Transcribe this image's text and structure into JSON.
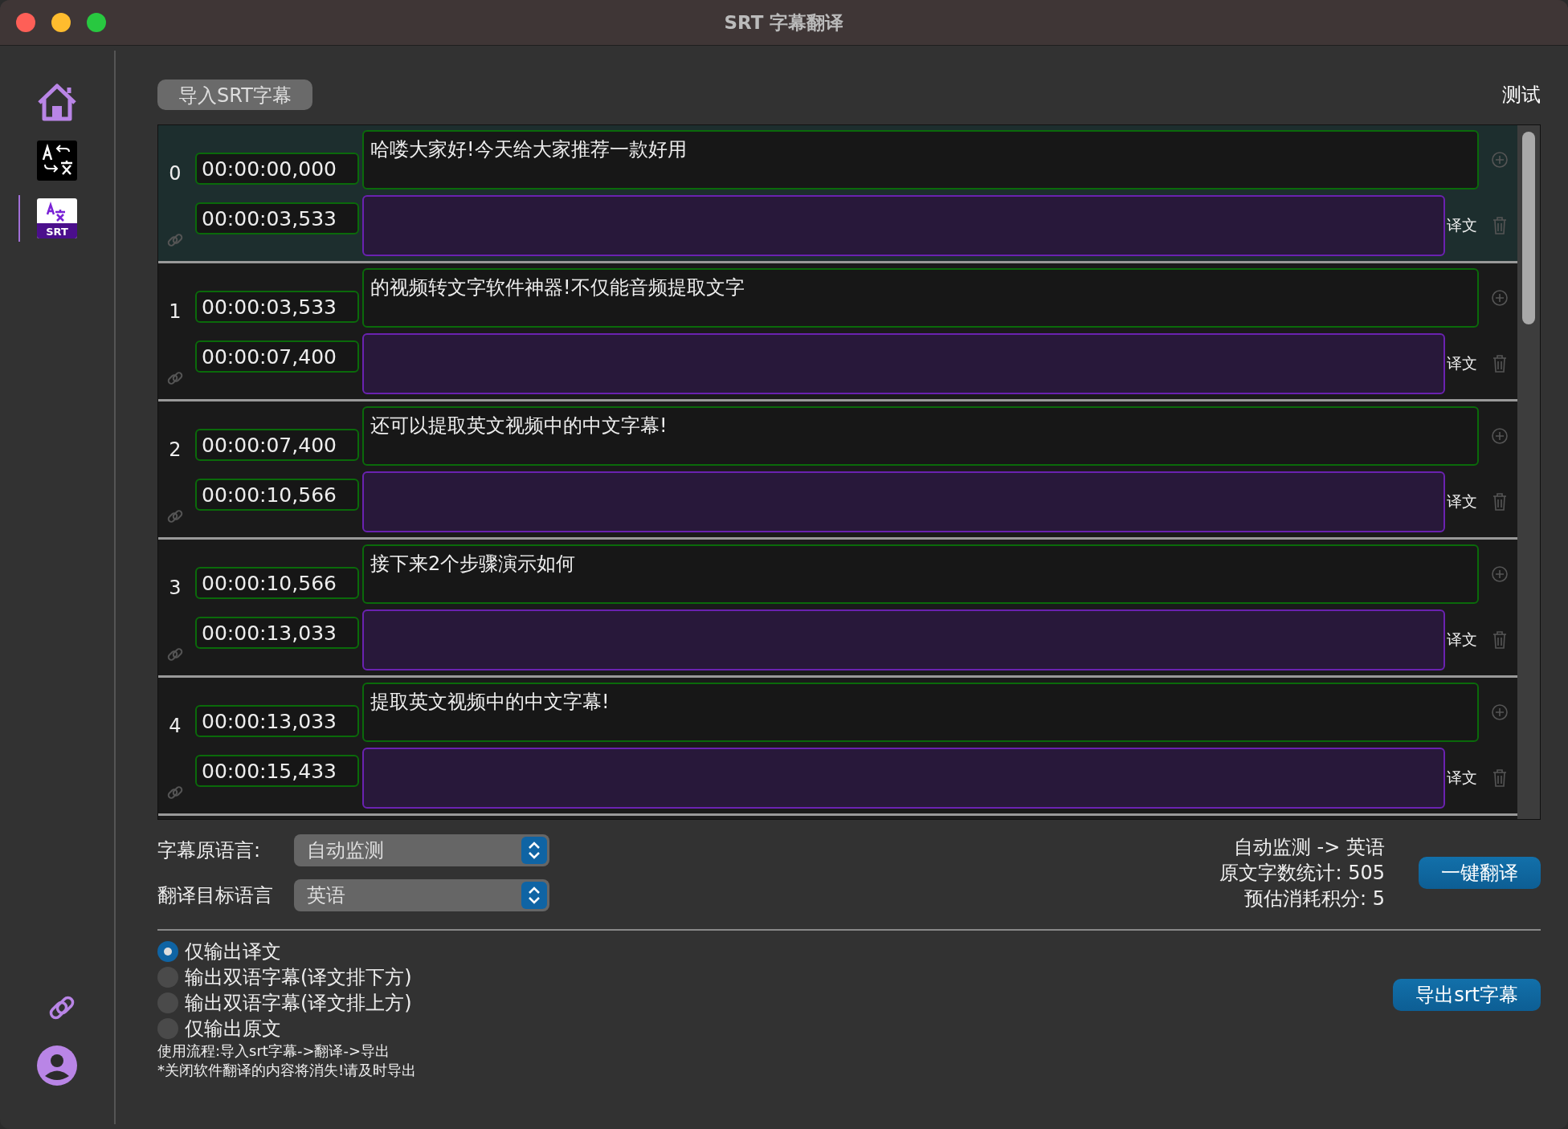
{
  "window": {
    "title": "SRT 字幕翻译"
  },
  "sidebar": {
    "items": [
      {
        "kind": "home",
        "selected": false
      },
      {
        "kind": "translate",
        "selected": false
      },
      {
        "kind": "srt",
        "label": "SRT",
        "selected": true
      }
    ],
    "bottom_items": [
      {
        "kind": "link"
      },
      {
        "kind": "account"
      }
    ]
  },
  "toolbar": {
    "import_button": "导入SRT字幕",
    "test_label": "测试"
  },
  "subtitles": [
    {
      "index": "0",
      "start": "00:00:00,000",
      "end": "00:00:03,533",
      "source": "哈喽大家好!今天给大家推荐一款好用",
      "translation_label": "译文",
      "selected": true
    },
    {
      "index": "1",
      "start": "00:00:03,533",
      "end": "00:00:07,400",
      "source": "的视频转文字软件神器!不仅能音频提取文字",
      "translation_label": "译文",
      "selected": false
    },
    {
      "index": "2",
      "start": "00:00:07,400",
      "end": "00:00:10,566",
      "source": "还可以提取英文视频中的中文字幕!",
      "translation_label": "译文",
      "selected": false
    },
    {
      "index": "3",
      "start": "00:00:10,566",
      "end": "00:00:13,033",
      "source": "接下来2个步骤演示如何",
      "translation_label": "译文",
      "selected": false
    },
    {
      "index": "4",
      "start": "00:00:13,033",
      "end": "00:00:15,433",
      "source": "提取英文视频中的中文字幕!",
      "translation_label": "译文",
      "selected": false
    }
  ],
  "settings": {
    "source_language_label": "字幕原语言:",
    "source_language": "自动监测",
    "target_language_label": "翻译目标语言",
    "target_language": "英语"
  },
  "stats": [
    "自动监测 -> 英语",
    "原文字数统计: 505",
    "预估消耗积分: 5"
  ],
  "translate_button": "一键翻译",
  "output_options": [
    {
      "label": "仅输出译文",
      "selected": true
    },
    {
      "label": "输出双语字幕(译文排下方)",
      "selected": false
    },
    {
      "label": "输出双语字幕(译文排上方)",
      "selected": false
    },
    {
      "label": "仅输出原文",
      "selected": false
    }
  ],
  "export_button": "导出srt字幕",
  "notes": [
    "使用流程:导入srt字幕->翻译->导出",
    "*关闭软件翻译的内容将消失!请及时导出"
  ]
}
